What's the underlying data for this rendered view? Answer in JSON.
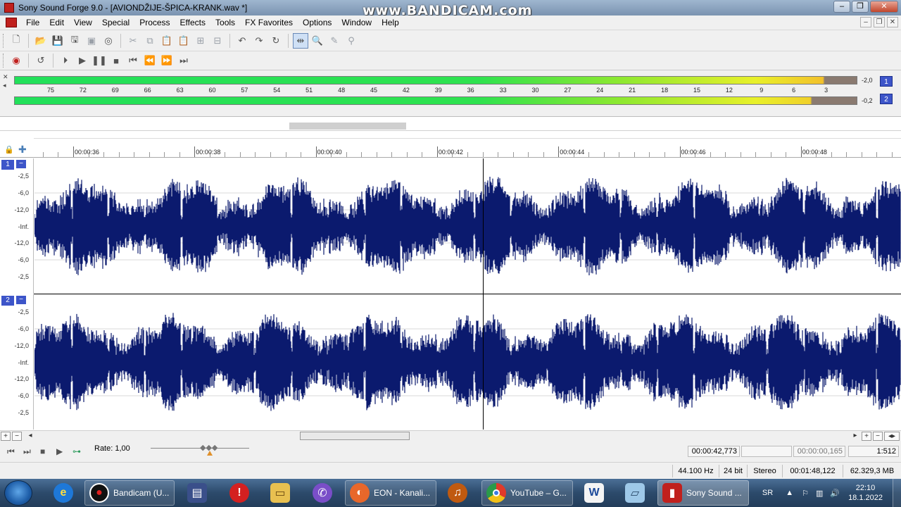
{
  "window": {
    "title": "Sony Sound Forge 9.0 - [AVIONDŽIJE-ŠPICA-KRANK.wav *]",
    "watermark": "www.BANDICAM.com",
    "controls": [
      "minimize-icon",
      "maximize-icon",
      "close-icon"
    ]
  },
  "menu": {
    "items": [
      "File",
      "Edit",
      "View",
      "Special",
      "Process",
      "Effects",
      "Tools",
      "FX Favorites",
      "Options",
      "Window",
      "Help"
    ]
  },
  "toolbar1": {
    "icons": [
      "new-icon",
      "open-icon",
      "save-icon",
      "save-as-icon",
      "render-icon",
      "properties-icon",
      "cut-icon",
      "copy-icon",
      "paste-icon",
      "paste-special-icon",
      "mix-icon",
      "crop-icon",
      "undo-icon",
      "redo-icon",
      "repeat-icon",
      "edit-tool-icon",
      "magnify-tool-icon",
      "pencil-tool-icon",
      "event-tool-icon"
    ]
  },
  "toolbar2": {
    "icons": [
      "record-icon",
      "loop-icon",
      "play-all-icon",
      "play-icon",
      "pause-icon",
      "stop-icon",
      "go-to-start-icon",
      "rewind-icon",
      "forward-icon",
      "go-to-end-icon"
    ]
  },
  "meters": {
    "scale": [
      "75",
      "72",
      "69",
      "66",
      "63",
      "60",
      "57",
      "54",
      "51",
      "48",
      "45",
      "42",
      "39",
      "36",
      "33",
      "30",
      "27",
      "24",
      "21",
      "18",
      "15",
      "12",
      "9",
      "6",
      "3"
    ],
    "channels": [
      {
        "number": "1",
        "peak": "-2,0",
        "level": 0.96
      },
      {
        "number": "2",
        "peak": "-0,2",
        "level": 0.945
      }
    ]
  },
  "ruler": {
    "labels": [
      "00:00:36",
      "00:00:38",
      "00:00:40",
      "00:00:42",
      "00:00:44",
      "00:00:46",
      "00:00:48"
    ]
  },
  "tracks": [
    {
      "number": "1",
      "minimize": "−",
      "db_labels": [
        "-2,5",
        "-6,0",
        "-12,0",
        "-Inf.",
        "-12,0",
        "-6,0",
        "-2,5"
      ]
    },
    {
      "number": "2",
      "minimize": "−",
      "db_labels": [
        "-2,5",
        "-6,0",
        "-12,0",
        "-Inf.",
        "-12,0",
        "-6,0",
        "-2,5"
      ]
    }
  ],
  "colors": {
    "waveform": "#0b1a6e",
    "channel_badge": "#3d55c9",
    "meter_green": "#2ee24f",
    "meter_yellow": "#e8f02a"
  },
  "transport": {
    "rate_label": "Rate: 1,00",
    "cursor_position": "00:00:42,773",
    "selection_length": "00:00:00,165",
    "zoom": "1:512"
  },
  "status": {
    "sample_rate": "44.100 Hz",
    "bit_depth": "24 bit",
    "channels": "Stereo",
    "length": "00:01:48,122",
    "free_space": "62.329,3 MB"
  },
  "taskbar": {
    "apps": [
      {
        "label": "",
        "icon": "ie-icon"
      },
      {
        "label": "Bandicam (U...",
        "icon": "bandicam-icon"
      },
      {
        "label": "",
        "icon": "floppy-icon"
      },
      {
        "label": "",
        "icon": "alert-icon"
      },
      {
        "label": "",
        "icon": "folder-icon"
      },
      {
        "label": "",
        "icon": "viber-icon"
      },
      {
        "label": "EON - Kanali...",
        "icon": "firefox-icon"
      },
      {
        "label": "",
        "icon": "headphones-icon"
      },
      {
        "label": "YouTube – G...",
        "icon": "chrome-icon"
      },
      {
        "label": "",
        "icon": "word-icon"
      },
      {
        "label": "",
        "icon": "notepad-icon"
      },
      {
        "label": "Sony Sound ...",
        "icon": "soundforge-icon"
      }
    ],
    "language": "SR",
    "time": "22:10",
    "date": "18.1.2022"
  }
}
